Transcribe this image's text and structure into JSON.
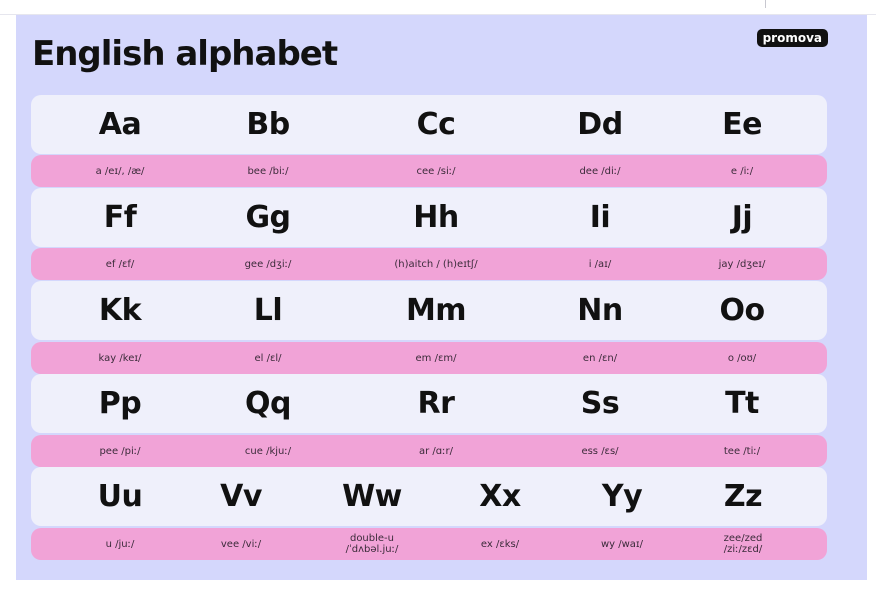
{
  "title": "English alphabet",
  "brand": "promova",
  "colors": {
    "poster_background": "#d4d7fc",
    "letter_row": "#eff0fb",
    "pronunciation_row": "#f1a3d7",
    "text": "#111111"
  },
  "rows": [
    {
      "letters": [
        "Aa",
        "Bb",
        "Cc",
        "Dd",
        "Ee"
      ],
      "sounds": [
        "a /eɪ/, /æ/",
        "bee /biː/",
        "cee /siː/",
        "dee /diː/",
        "e /iː/"
      ]
    },
    {
      "letters": [
        "Ff",
        "Gg",
        "Hh",
        "Ii",
        "Jj"
      ],
      "sounds": [
        "ef /ɛf/",
        "gee /dʒiː/",
        "(h)aitch / (h)eɪtʃ/",
        "i /aɪ/",
        "jay /dʒeɪ/"
      ]
    },
    {
      "letters": [
        "Kk",
        "Ll",
        "Mm",
        "Nn",
        "Oo"
      ],
      "sounds": [
        "kay /keɪ/",
        "el /ɛl/",
        "em /ɛm/",
        "en /ɛn/",
        "o /oʊ/"
      ]
    },
    {
      "letters": [
        "Pp",
        "Qq",
        "Rr",
        "Ss",
        "Tt"
      ],
      "sounds": [
        "pee /piː/",
        "cue /kjuː/",
        "ar /ɑːr/",
        "ess /ɛs/",
        "tee /tiː/"
      ]
    },
    {
      "letters": [
        "Uu",
        "Vv",
        "Ww",
        "Xx",
        "Yy",
        "Zz"
      ],
      "sounds": [
        "u /juː/",
        "vee /viː/",
        "double-u\n/ˈdʌbəl.juː/",
        "ex /ɛks/",
        "wy /waɪ/",
        "zee/zed\n/ziː/zɛd/"
      ]
    }
  ]
}
